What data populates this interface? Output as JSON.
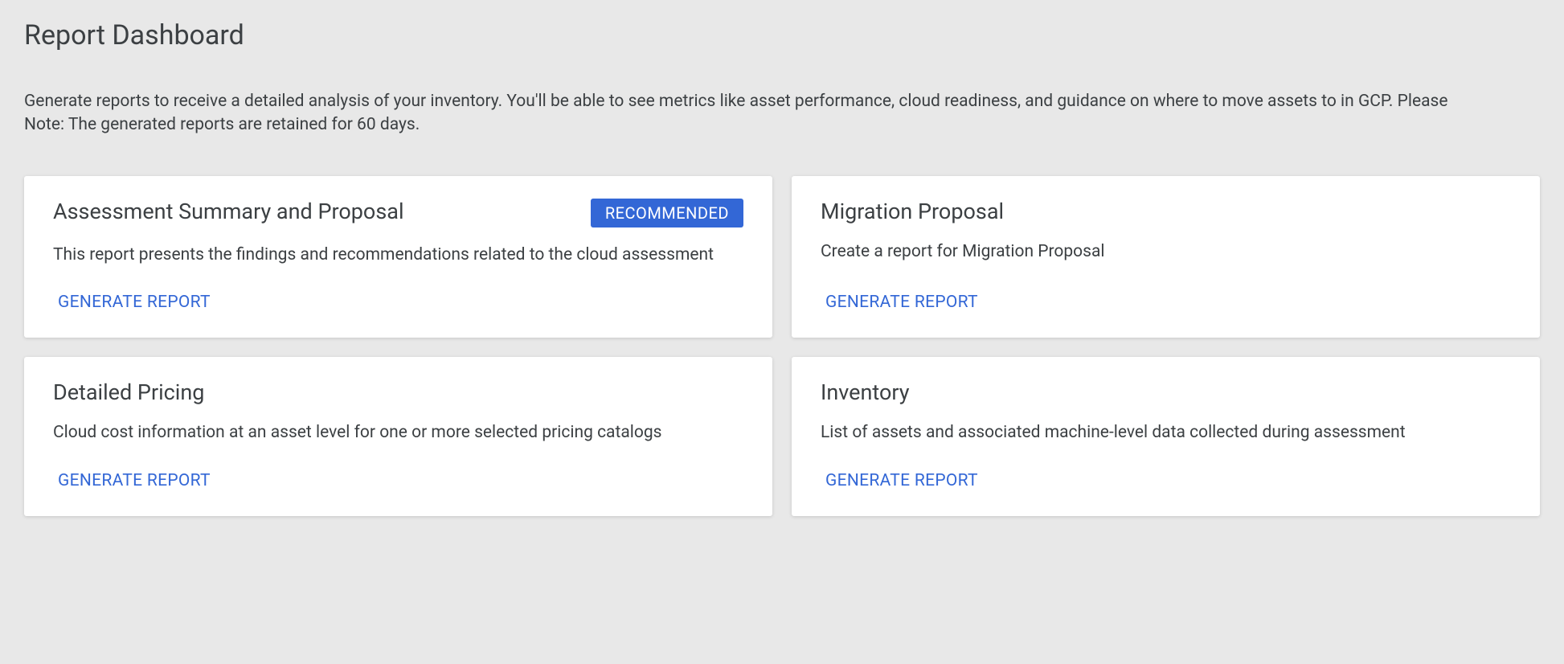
{
  "header": {
    "title": "Report Dashboard",
    "description": "Generate reports to receive a detailed analysis of your inventory. You'll be able to see metrics like asset performance, cloud readiness, and guidance on where to move assets to in GCP. Please Note: The generated reports are retained for 60 days."
  },
  "cards": {
    "assessment": {
      "title": "Assessment Summary and Proposal",
      "badge": "RECOMMENDED",
      "description": "This report presents the findings and recommendations related to the cloud assessment",
      "button": "GENERATE REPORT"
    },
    "migration": {
      "title": "Migration Proposal",
      "description": "Create a report for Migration Proposal",
      "button": "GENERATE REPORT"
    },
    "pricing": {
      "title": "Detailed Pricing",
      "description": "Cloud cost information at an asset level for one or more selected pricing catalogs",
      "button": "GENERATE REPORT"
    },
    "inventory": {
      "title": "Inventory",
      "description": "List of assets and associated machine-level data collected during assessment",
      "button": "GENERATE REPORT"
    }
  }
}
